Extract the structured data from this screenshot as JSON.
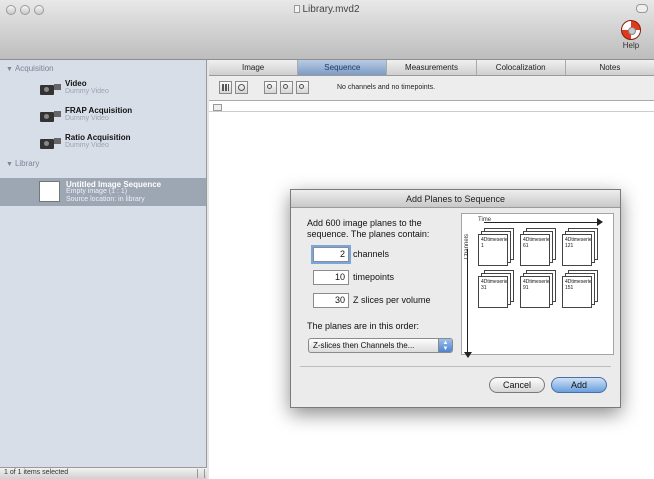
{
  "window": {
    "title": "Library.mvd2",
    "help_label": "Help"
  },
  "sidebar": {
    "acquisition_header": "Acquisition",
    "acquisition_items": [
      {
        "name": "Video",
        "sub": "Dummy Video"
      },
      {
        "name": "FRAP Acquisition",
        "sub": "Dummy Video"
      },
      {
        "name": "Ratio Acquisition",
        "sub": "Dummy Video"
      }
    ],
    "library_header": "Library",
    "library_item": {
      "name": "Untitled Image Sequence",
      "sub1": "Empty image (1 : 1)",
      "sub2": "Source location: in library"
    },
    "status": "1 of 1 items selected"
  },
  "main": {
    "tabs": [
      "Image",
      "Sequence",
      "Measurements",
      "Colocalization",
      "Notes"
    ],
    "active_tab": "Sequence",
    "toolbar_message": "No channels and no timepoints."
  },
  "dialog": {
    "title": "Add Planes to Sequence",
    "intro": "Add 600 image planes to the sequence.  The planes contain:",
    "channels_value": "2",
    "channels_label": "channels",
    "timepoints_value": "10",
    "timepoints_label": "timepoints",
    "zslices_value": "30",
    "zslices_label": "Z slices per volume",
    "order_label": "The planes are in this order:",
    "order_value": "Z-slices then Channels the...",
    "cancel_label": "Cancel",
    "add_label": "Add",
    "illustration": {
      "time_label": "Time",
      "channels_label": "Channels",
      "stacks": [
        {
          "text": "4Dtimeseries.ics 1"
        },
        {
          "text": "4Dtimeseries.ics 61"
        },
        {
          "text": "4Dtimeseries.ics 121"
        },
        {
          "text": "4Dtimeseries.ics 31"
        },
        {
          "text": "4Dtimeseries.ics 91"
        },
        {
          "text": "4Dtimeseries.ics 151"
        }
      ]
    }
  }
}
